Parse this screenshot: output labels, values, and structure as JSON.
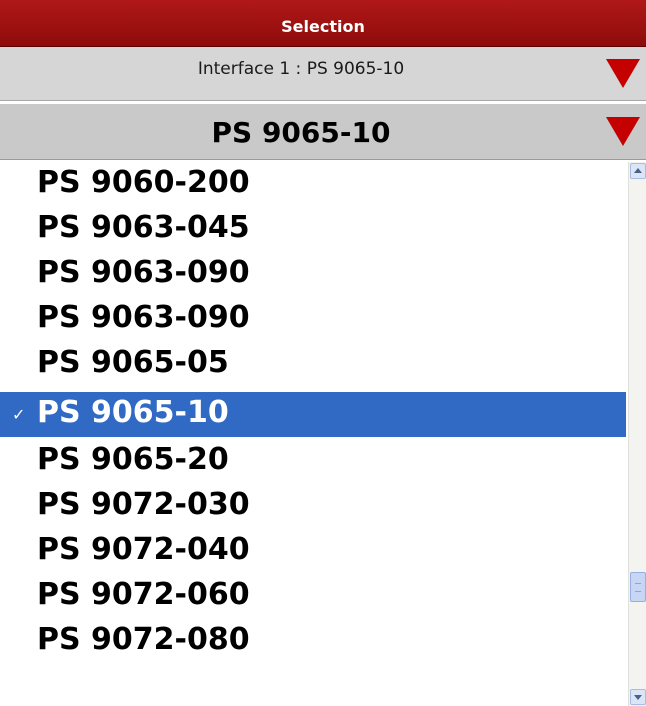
{
  "header": {
    "title": "Selection"
  },
  "interface_selector": {
    "label": "Interface 1 : PS 9065-10",
    "icon": "dropdown-arrow-icon",
    "arrow_color": "#c40000"
  },
  "model_selector": {
    "value": "PS 9065-10",
    "icon": "dropdown-arrow-icon",
    "arrow_color": "#c40000"
  },
  "options": [
    {
      "label": "PS 9060-200",
      "selected": false
    },
    {
      "label": "PS 9063-045",
      "selected": false
    },
    {
      "label": "PS 9063-090",
      "selected": false
    },
    {
      "label": "PS 9063-090",
      "selected": false
    },
    {
      "label": "PS 9065-05",
      "selected": false
    },
    {
      "label": "PS 9065-10",
      "selected": true,
      "check": "✓"
    },
    {
      "label": "PS 9065-20",
      "selected": false
    },
    {
      "label": "PS 9072-030",
      "selected": false
    },
    {
      "label": "PS 9072-040",
      "selected": false
    },
    {
      "label": "PS 9072-060",
      "selected": false
    },
    {
      "label": "PS 9072-080",
      "selected": false
    }
  ],
  "colors": {
    "header_bg": "#a01010",
    "selection_bg": "#316ac5",
    "row_bg": "#d6d6d6"
  }
}
